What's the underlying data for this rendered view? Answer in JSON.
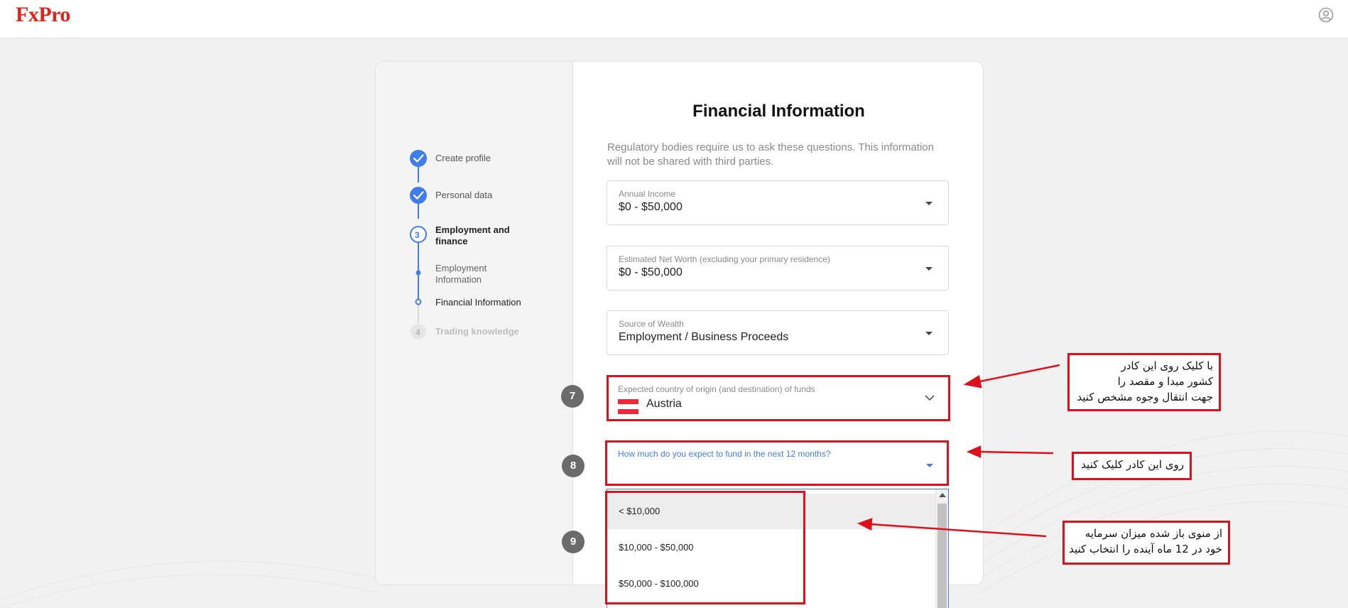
{
  "brand": {
    "logo": "FxPro"
  },
  "header": {
    "user_icon": "user-circle-icon"
  },
  "steps": [
    {
      "label": "Create profile",
      "state": "done"
    },
    {
      "label": "Personal data",
      "state": "done"
    },
    {
      "number": "3",
      "label": "Employment and finance",
      "state": "active"
    },
    {
      "label": "Employment Information",
      "state": "done-sub"
    },
    {
      "label": "Financial Information",
      "state": "current-sub"
    },
    {
      "number": "4",
      "label": "Trading knowledge",
      "state": "pending"
    }
  ],
  "form": {
    "title": "Financial Information",
    "intro": "Regulatory bodies require us to ask these questions. This information will not be shared with third parties.",
    "annual_income": {
      "label": "Annual Income",
      "value": "$0 - $50,000"
    },
    "net_worth": {
      "label": "Estimated Net Worth (excluding your primary residence)",
      "value": "$0 - $50,000"
    },
    "source_of_wealth": {
      "label": "Source of Wealth",
      "value": "Employment / Business Proceeds"
    },
    "country": {
      "label": "Expected country of origin (and destination) of funds",
      "value": "Austria",
      "flag": "austria-flag"
    },
    "fund_amount": {
      "label": "How much do you expect to fund in the next 12 months?",
      "value": ""
    },
    "fund_options": [
      "< $10,000",
      "$10,000 - $50,000",
      "$50,000 - $100,000"
    ]
  },
  "markers": [
    "7",
    "8",
    "9"
  ],
  "annotations": {
    "note_country": [
      "با کلیک روی این کادر",
      "کشور مبدا و مقصد را",
      "جهت انتقال وجوه مشخص کنید"
    ],
    "note_click": [
      "روی این کادر کلیک کنید"
    ],
    "note_amount": [
      "از منوی باز شده میزان سرمایه",
      "خود در 12 ماه آینده را انتخاب کنید"
    ]
  },
  "colors": {
    "brand_red": "#e0241b",
    "accent_blue": "#3f7de8",
    "annotation_red": "#e0101a",
    "marker_gray": "#6b6b6b"
  }
}
